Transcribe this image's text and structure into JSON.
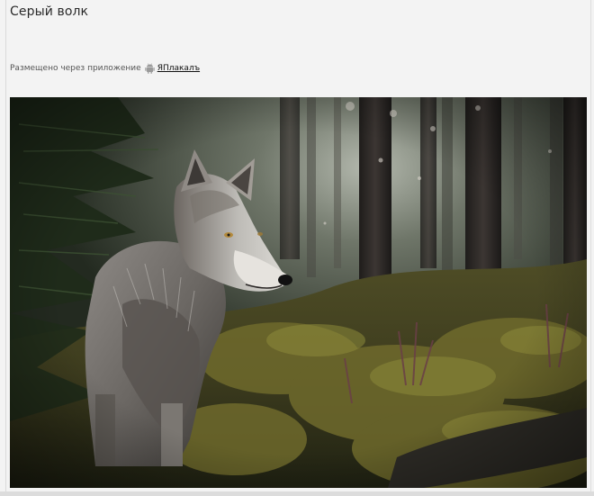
{
  "post": {
    "title": "Серый волк",
    "posted_via_text": "Размещено через приложение",
    "app_name": "ЯПлакалъ",
    "platform_icon": "android-icon"
  },
  "image": {
    "subject": "wolf-in-forest",
    "palette": {
      "forest_dark": "#1e2419",
      "fog": "#8a9184",
      "moss": "#6e6a2e",
      "fur_light": "#cfcfcf",
      "fur_dark": "#4a4642"
    }
  }
}
